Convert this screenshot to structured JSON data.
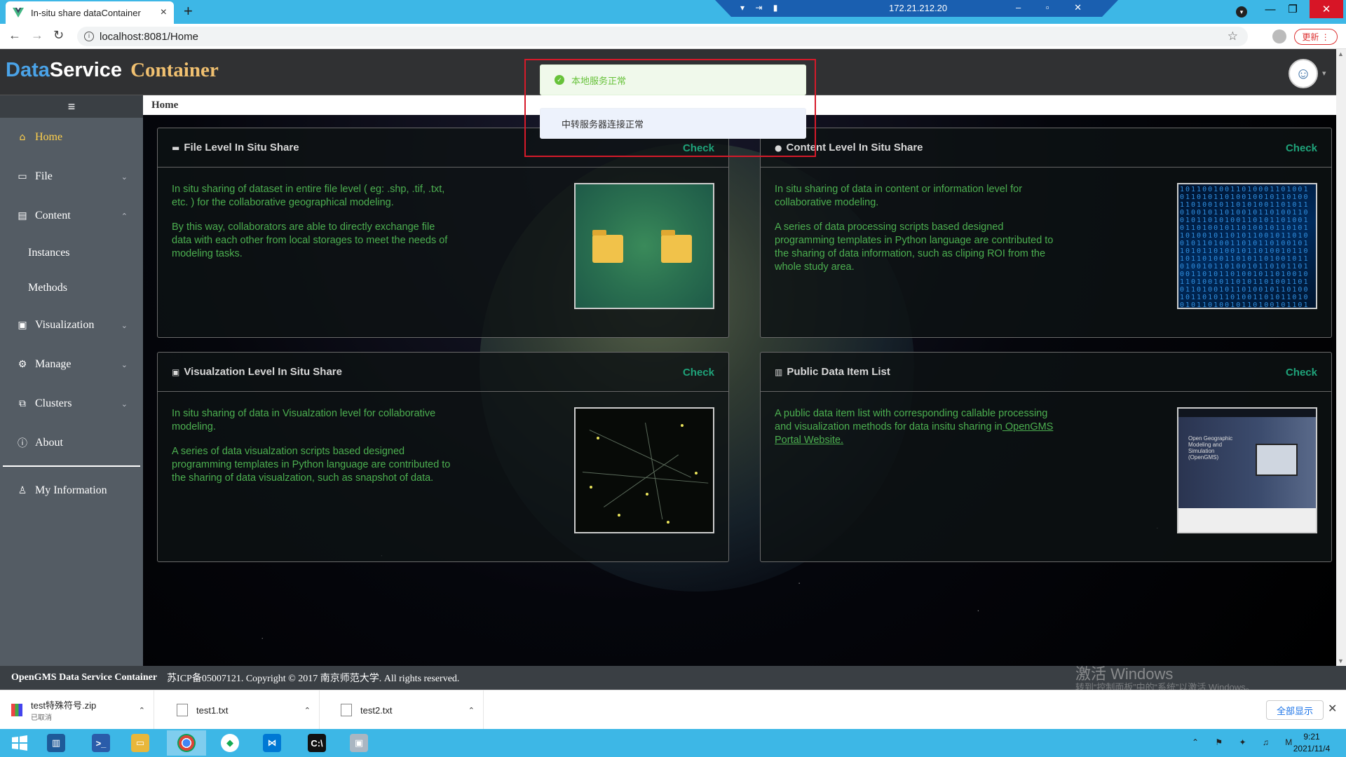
{
  "browser": {
    "tab_title": "In-situ share dataContainer",
    "tab_close": "×",
    "new_tab": "+",
    "remote_ip": "172.21.212.20",
    "url": "localhost:8081/Home",
    "update_label": "更新"
  },
  "header": {
    "brand_part1": "Data",
    "brand_part2": "Service",
    "brand_part3": "Container"
  },
  "sidebar": {
    "toggle_glyph": "≡",
    "items": [
      {
        "label": "Home",
        "icon": "home-icon",
        "active": true
      },
      {
        "label": "File",
        "icon": "folder-icon"
      },
      {
        "label": "Content",
        "icon": "content-icon"
      },
      {
        "label": "Instances",
        "sub": true
      },
      {
        "label": "Methods",
        "sub": true
      },
      {
        "label": "Visualization",
        "icon": "image-icon"
      },
      {
        "label": "Manage",
        "icon": "gear-icon"
      },
      {
        "label": "Clusters",
        "icon": "cluster-icon"
      },
      {
        "label": "About",
        "icon": "info-icon"
      },
      {
        "label": "My Information",
        "icon": "user-icon"
      }
    ]
  },
  "breadcrumb": "Home",
  "cards": [
    {
      "title": "File Level In Situ Share",
      "check": "Check",
      "p1": "In situ sharing of dataset in entire file level ( eg: .shp, .tif, .txt, etc. ) for the collaborative geographical modeling.",
      "p2": "By this way, collaborators are able to directly exchange file data with each other from local storages to meet the needs of modeling tasks."
    },
    {
      "title": "Content Level In Situ Share",
      "check": "Check",
      "p1": "In situ sharing of data in content or information level for collaborative modeling.",
      "p2": "A series of data processing scripts based designed programming templates in Python language are contributed to the sharing of data information, such as cliping ROI from the whole study area."
    },
    {
      "title": "Visualzation Level In Situ Share",
      "check": "Check",
      "p1": "In situ sharing of data in Visualzation level for collaborative modeling.",
      "p2": "A series of data visualzation scripts based designed programming templates in Python language are contributed to the sharing of data visualzation, such as snapshot of data."
    },
    {
      "title": "Public Data Item List",
      "check": "Check",
      "p1": "A public data item list with corresponding callable processing and visualization methods for data insitu sharing in",
      "link": " OpenGMS Portal Website."
    }
  ],
  "notifications": {
    "success": "本地服务正常",
    "info": "中转服务器连接正常"
  },
  "footer": {
    "brand": "OpenGMS Data Service Container",
    "copyright": "苏ICP备05007121. Copyright © 2017 南京师范大学. All rights reserved."
  },
  "watermark": {
    "line1": "激活 Windows",
    "line2": "转到“控制面板”中的“系统”以激活 Windows。"
  },
  "downloads": [
    {
      "name": "test特殊符号.zip",
      "status": "已取消"
    },
    {
      "name": "test1.txt",
      "status": ""
    },
    {
      "name": "test2.txt",
      "status": ""
    }
  ],
  "download_show_all": "全部显示",
  "clock": {
    "time": "9:21",
    "date": "2021/11/4"
  }
}
